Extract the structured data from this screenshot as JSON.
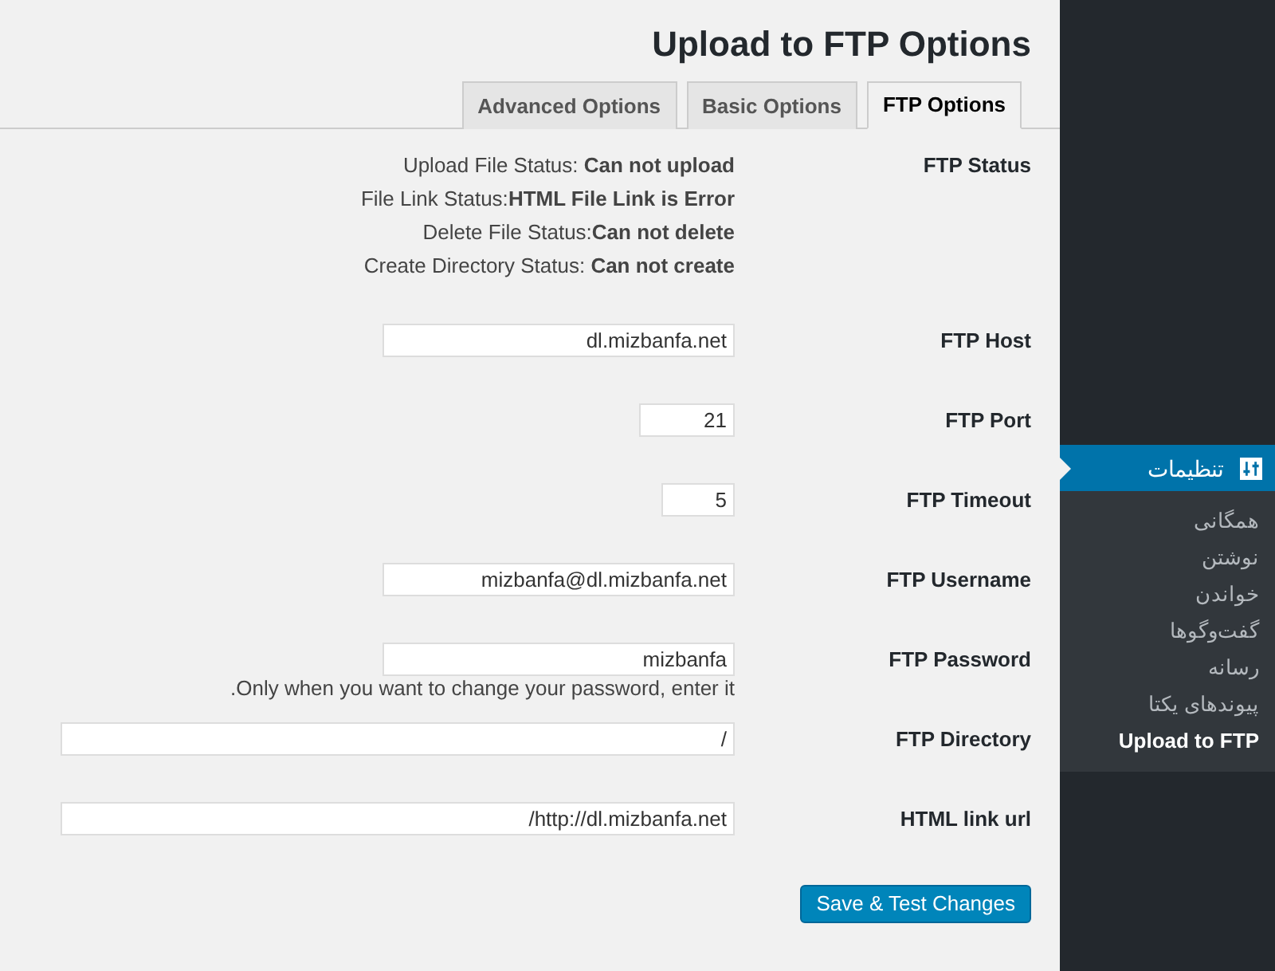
{
  "title": "Upload to FTP Options",
  "tabs": [
    {
      "label": "Advanced Options",
      "selected": false
    },
    {
      "label": "Basic Options",
      "selected": false
    },
    {
      "label": "FTP Options",
      "selected": true
    }
  ],
  "status": {
    "label": "FTP Status",
    "lines": [
      "Upload File Status: **Can not upload**",
      "File Link Status:**HTML File Link is Error**",
      "Delete File Status:**Can not delete**",
      "Create Directory Status: **Can not create**"
    ]
  },
  "fields": [
    {
      "label": "FTP Host",
      "value": "dl.mizbanfa.net",
      "kind": "medium"
    },
    {
      "label": "FTP Port",
      "value": "21",
      "kind": "short"
    },
    {
      "label": "FTP Timeout",
      "value": "5",
      "kind": "tiny"
    },
    {
      "label": "FTP Username",
      "value": "mizbanfa@dl.mizbanfa.net",
      "kind": "medium"
    },
    {
      "label": "FTP Password",
      "value": "mizbanfa",
      "kind": "medium",
      "hint": ".Only when you want to change your password, enter it"
    },
    {
      "label": "FTP Directory",
      "value": "/",
      "kind": "wide"
    },
    {
      "label": "HTML link url",
      "value": "/http://dl.mizbanfa.net",
      "kind": "wide"
    }
  ],
  "save_button": "Save & Test Changes",
  "sidebar": {
    "menu": {
      "label": "تنظیمات",
      "selected": true
    },
    "submenu": [
      {
        "label": "همگانی",
        "selected": false
      },
      {
        "label": "نوشتن",
        "selected": false
      },
      {
        "label": "خواندن",
        "selected": false
      },
      {
        "label": "گفت‌وگوها",
        "selected": false
      },
      {
        "label": "رسانه",
        "selected": false
      },
      {
        "label": "پیوندهای یکتا",
        "selected": false
      },
      {
        "label": "Upload to FTP",
        "selected": true
      }
    ]
  }
}
